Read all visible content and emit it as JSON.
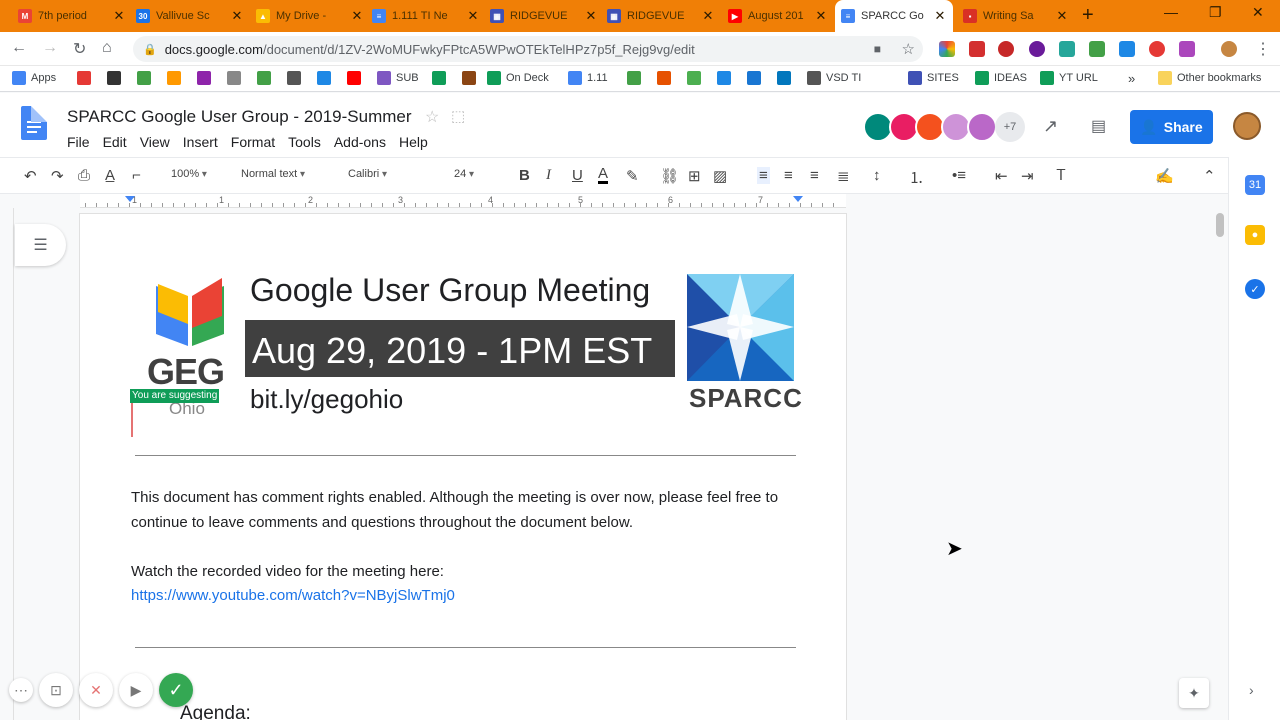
{
  "browser": {
    "tabs": [
      {
        "label": "7th period",
        "color": "#ea4335",
        "glyph": "M"
      },
      {
        "label": "Vallivue Sc",
        "color": "#1a73e8",
        "glyph": "30"
      },
      {
        "label": "My Drive -",
        "color": "#fbbc04",
        "glyph": "▲"
      },
      {
        "label": "1.111 TI Ne",
        "color": "#4285f4",
        "glyph": "≡"
      },
      {
        "label": "RIDGEVUE",
        "color": "#3f51b5",
        "glyph": "▦"
      },
      {
        "label": "RIDGEVUE",
        "color": "#3f51b5",
        "glyph": "▦"
      },
      {
        "label": "August 201",
        "color": "#ff0000",
        "glyph": "▶"
      },
      {
        "label": "SPARCC Go",
        "color": "#4285f4",
        "glyph": "≡"
      },
      {
        "label": "Writing Sa",
        "color": "#d93025",
        "glyph": "▪"
      }
    ],
    "url_domain": "docs.google.com",
    "url_path": "/document/d/1ZV-2WoMUFwkyFPtcA5WPwOTEkTelHPz7p5f_Rejg9vg/edit",
    "bookmarks": [
      {
        "label": "Apps",
        "color": "#4285f4"
      },
      {
        "label": "",
        "color": "#e53935"
      },
      {
        "label": "",
        "color": "#333333"
      },
      {
        "label": "",
        "color": "#43a047"
      },
      {
        "label": "",
        "color": "#ff9900"
      },
      {
        "label": "",
        "color": "#8e24aa"
      },
      {
        "label": "",
        "color": "#888888"
      },
      {
        "label": "",
        "color": "#43a047"
      },
      {
        "label": "",
        "color": "#555555"
      },
      {
        "label": "",
        "color": "#1e88e5"
      },
      {
        "label": "",
        "color": "#ff0000"
      },
      {
        "label": "SUB",
        "color": "#7e57c2"
      },
      {
        "label": "",
        "color": "#0f9d58"
      },
      {
        "label": "",
        "color": "#8b4513"
      },
      {
        "label": "On Deck",
        "color": "#0f9d58"
      },
      {
        "label": "1.11",
        "color": "#4285f4"
      },
      {
        "label": "",
        "color": "#43a047"
      },
      {
        "label": "",
        "color": "#e65100"
      },
      {
        "label": "",
        "color": "#4caf50"
      },
      {
        "label": "",
        "color": "#1e88e5"
      },
      {
        "label": "",
        "color": "#1976d2"
      },
      {
        "label": "",
        "color": "#0277bd"
      },
      {
        "label": "VSD TI",
        "color": "#555555"
      },
      {
        "label": "SITES",
        "color": "#3f51b5"
      },
      {
        "label": "IDEAS",
        "color": "#0f9d58"
      },
      {
        "label": "YT URL",
        "color": "#0f9d58"
      }
    ],
    "bookmarks_overflow": "»",
    "other_bookmarks": "Other bookmarks"
  },
  "docs": {
    "title": "SPARCC Google User Group - 2019-Summer",
    "menu": [
      "File",
      "Edit",
      "View",
      "Insert",
      "Format",
      "Tools",
      "Add-ons",
      "Help"
    ],
    "collaborators_more": "+7",
    "share_label": "Share",
    "zoom": "100%",
    "style": "Normal text",
    "font": "Calibri",
    "font_size": "24",
    "ruler_numbers": [
      "1",
      "1",
      "2",
      "3",
      "4",
      "5",
      "6",
      "7"
    ]
  },
  "document": {
    "banner_title": "Google User Group Meeting",
    "banner_date": "Aug 29, 2019 - 1PM EST",
    "banner_link": "bit.ly/gegohio",
    "geg_text": "GEG",
    "ohio_text": "Ohio",
    "sparcc_text": "SPARCC",
    "suggesting_badge": "You are suggesting",
    "para1": "This document has comment rights enabled. Although the meeting is over now, please feel free to continue to leave comments and questions throughout the document below.",
    "para2": "Watch the recorded video for the meeting here:",
    "video_link": "https://www.youtube.com/watch?v=NByjSlwTmj0",
    "agenda_heading": "Agenda:"
  }
}
